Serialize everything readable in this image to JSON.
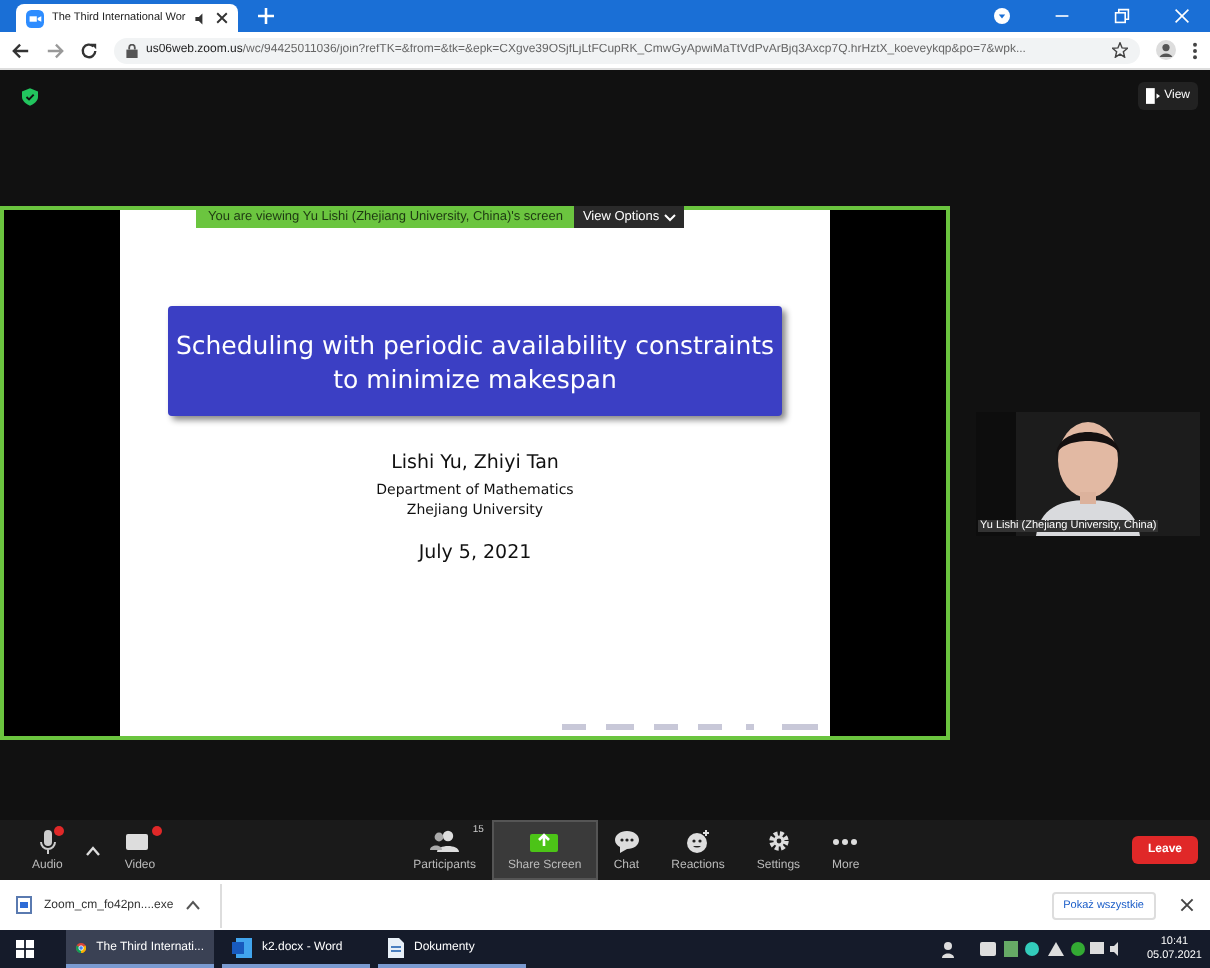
{
  "browser": {
    "tab_title": "The Third International Wor",
    "url_host": "us06web.zoom.us",
    "url_path": "/wc/94425011036/join?refTK=&from=&tk=&epk=CXgve39OSjfLjLtFCupRK_CmwGyApwiMaTtVdPvArBjq3Axcp7Q.hrHztX_koeveykqp&po=7&wpk..."
  },
  "meeting": {
    "view_button": "View",
    "banner": "You are viewing Yu Lishi (Zhejiang University, China)'s screen",
    "view_options": "View Options",
    "slide": {
      "title_lines": [
        "Scheduling with periodic availability constraints",
        "to minimize makespan"
      ],
      "authors": "Lishi Yu, Zhiyi Tan",
      "department": "Department of Mathematics",
      "university": "Zhejiang University",
      "date": "July 5, 2021"
    },
    "video_name": "Yu Lishi (Zhejiang University, China)"
  },
  "toolbar": [
    {
      "kind": "audio",
      "label": "Audio",
      "alert": true,
      "selected": false
    },
    {
      "kind": "caret"
    },
    {
      "kind": "video",
      "label": "Video",
      "alert": true,
      "selected": false
    },
    {
      "kind": "participants",
      "label": "Participants",
      "count": "15",
      "selected": false
    },
    {
      "kind": "share",
      "label": "Share Screen",
      "selected": true
    },
    {
      "kind": "chat",
      "label": "Chat",
      "selected": false
    },
    {
      "kind": "reactions",
      "label": "Reactions",
      "selected": false
    },
    {
      "kind": "settings",
      "label": "Settings",
      "selected": false
    },
    {
      "kind": "more",
      "label": "More",
      "selected": false
    }
  ],
  "leave": "Leave",
  "downloads": {
    "file": "Zoom_cm_fo42pn....exe",
    "show_all": "Pokaż wszystkie"
  },
  "taskbar": {
    "items": [
      {
        "kind": "chrome",
        "label": "The Third Internati...",
        "selected": true
      },
      {
        "kind": "word",
        "label": "k2.docx - Word",
        "selected": false
      },
      {
        "kind": "file",
        "label": "Dokumenty",
        "selected": false
      }
    ],
    "time": "10:41",
    "date": "05.07.2021"
  }
}
